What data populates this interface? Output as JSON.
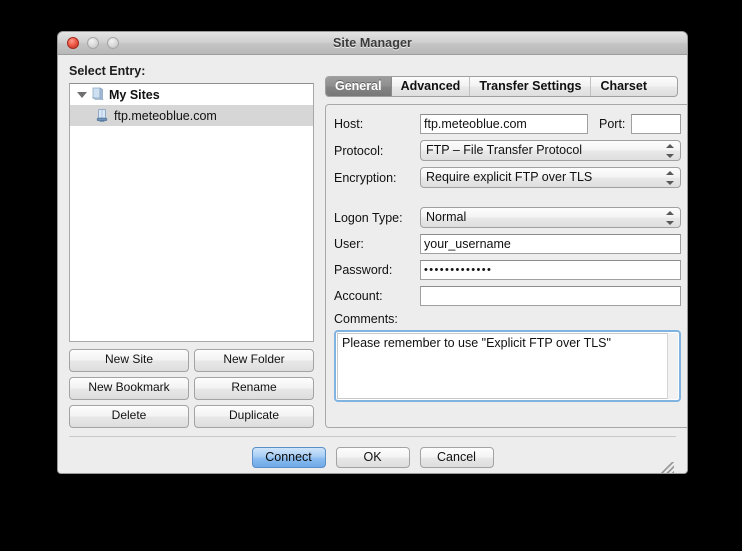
{
  "window": {
    "title": "Site Manager",
    "traffic_lights": [
      {
        "name": "close",
        "label": "close"
      },
      {
        "name": "minimize",
        "label": "minimize"
      },
      {
        "name": "zoom",
        "label": "zoom"
      }
    ]
  },
  "left": {
    "pane_label": "Select Entry:",
    "tree": [
      {
        "label": "My Sites",
        "icon": "server-icon",
        "selected": false,
        "expanded": true,
        "level": 0
      },
      {
        "label": "ftp.meteoblue.com",
        "icon": "server-icon",
        "selected": true,
        "expanded": false,
        "level": 1
      }
    ],
    "buttons": [
      {
        "label": "New Site",
        "name": "new-site-button"
      },
      {
        "label": "New Folder",
        "name": "new-folder-button"
      },
      {
        "label": "New Bookmark",
        "name": "new-bookmark-button"
      },
      {
        "label": "Rename",
        "name": "rename-button"
      },
      {
        "label": "Delete",
        "name": "delete-button"
      },
      {
        "label": "Duplicate",
        "name": "duplicate-button"
      }
    ]
  },
  "tabs": [
    {
      "label": "General",
      "active": true
    },
    {
      "label": "Advanced",
      "active": false
    },
    {
      "label": "Transfer Settings",
      "active": false
    },
    {
      "label": "Charset",
      "active": false
    }
  ],
  "general": {
    "host_label": "Host:",
    "host_value": "ftp.meteoblue.com",
    "port_label": "Port:",
    "port_value": "",
    "protocol_label": "Protocol:",
    "protocol_value": "FTP – File Transfer Protocol",
    "encryption_label": "Encryption:",
    "encryption_value": "Require explicit FTP over TLS",
    "logon_type_label": "Logon Type:",
    "logon_type_value": "Normal",
    "user_label": "User:",
    "user_value": "your_username",
    "password_label": "Password:",
    "password_value": "•••••••••••••",
    "account_label": "Account:",
    "account_value": "",
    "comments_label": "Comments:",
    "comments_value": "Please remember to use \"Explicit FTP over TLS\""
  },
  "footer": {
    "buttons": [
      {
        "label": "Connect",
        "name": "connect-button",
        "default": true
      },
      {
        "label": "OK",
        "name": "ok-button",
        "default": false
      },
      {
        "label": "Cancel",
        "name": "cancel-button",
        "default": false
      }
    ]
  },
  "colors": {
    "accent_default_button": "#8bbdf0",
    "focus_ring": "#81b3e0",
    "window_bg": "#ededed",
    "selection": "#d6d6d6",
    "active_tab": "#878787"
  }
}
